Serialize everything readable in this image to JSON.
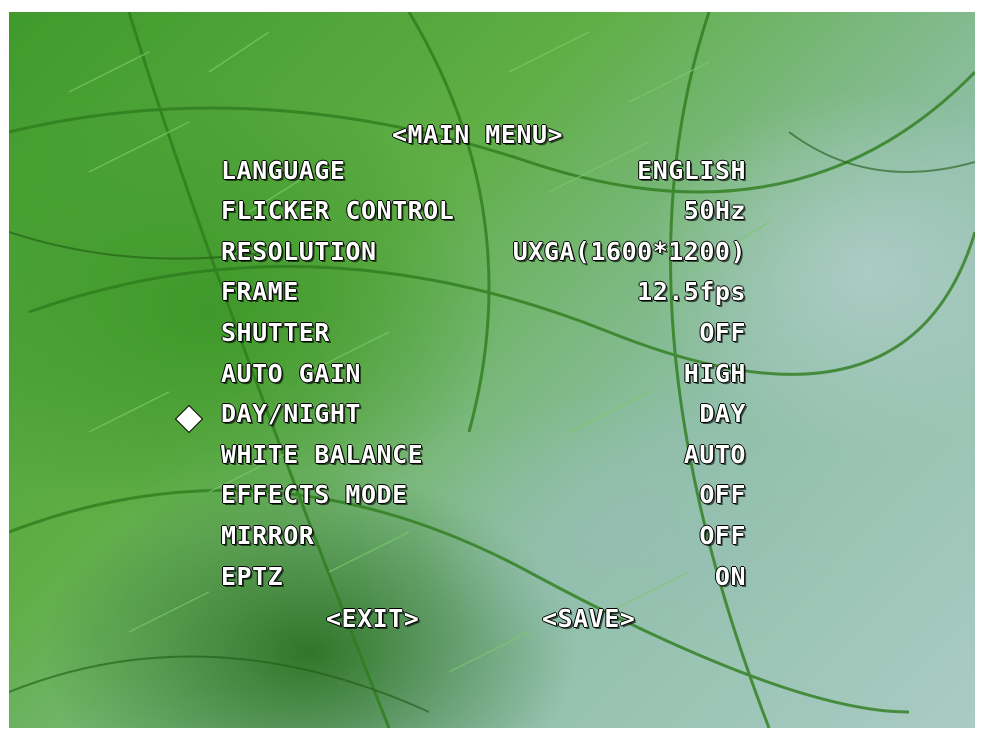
{
  "menu": {
    "title": "<MAIN MENU>",
    "items": [
      {
        "label": "LANGUAGE",
        "value": "ENGLISH"
      },
      {
        "label": "FLICKER CONTROL",
        "value": "50Hz"
      },
      {
        "label": "RESOLUTION",
        "value": "UXGA(1600*1200)"
      },
      {
        "label": "FRAME",
        "value": "12.5fps"
      },
      {
        "label": "SHUTTER",
        "value": "OFF"
      },
      {
        "label": "AUTO GAIN",
        "value": "HIGH"
      },
      {
        "label": "DAY/NIGHT",
        "value": "DAY"
      },
      {
        "label": "WHITE BALANCE",
        "value": "AUTO"
      },
      {
        "label": "EFFECTS MODE",
        "value": "OFF"
      },
      {
        "label": "MIRROR",
        "value": "OFF"
      },
      {
        "label": "EPTZ",
        "value": "ON"
      }
    ],
    "selected_index": 6,
    "cursor_icon": "diamond-cursor-icon",
    "exit_label": "<EXIT>",
    "save_label": "<SAVE>"
  },
  "colors": {
    "osd_text": "#ffffff",
    "text_outline": "#000000"
  }
}
